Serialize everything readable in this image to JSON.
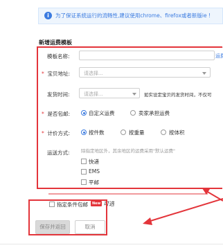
{
  "notice": {
    "icon": "info-icon",
    "icon_glyph": "i",
    "text": "为了保证系统运行的流畅性,建议使用chrome、firefox或者新版ie !"
  },
  "section_title": "新增运费模板",
  "form": {
    "template_name": {
      "label": "模板名称:",
      "link": "运费"
    },
    "shipping_address": {
      "label": "宝贝地址:",
      "placeholder": "请选择..."
    },
    "ship_time": {
      "label": "发货时间:",
      "placeholder": "请选择...",
      "hint": "如实设定宝贝的发货时间，不仅可"
    },
    "free_shipping": {
      "label": "是否包邮:",
      "options": [
        "自定义运费",
        "卖家承担运费"
      ],
      "selected": 0
    },
    "pricing": {
      "label": "计价方式:",
      "options": [
        "按件数",
        "按重量",
        "按体积"
      ],
      "selected": 0
    },
    "delivery": {
      "label": "运送方式:",
      "hint": "除指定地区外，其余地区的运费采用\"默认运费\"",
      "options": [
        "快递",
        "EMS",
        "平邮"
      ]
    },
    "conditional_free": {
      "label": "指定条件包邮",
      "badge": "New",
      "note": "可选"
    }
  },
  "buttons": {
    "save": "保存并返回",
    "cancel": "取消"
  },
  "colors": {
    "accent": "#3b7be0",
    "annotation_red": "#e3343a",
    "required_red": "#e3343a"
  }
}
